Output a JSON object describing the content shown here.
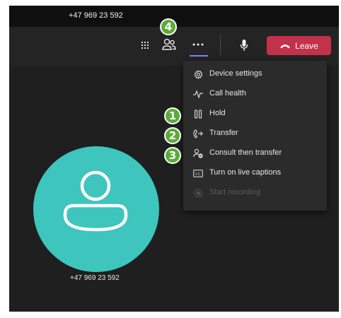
{
  "window": {
    "title": "+47 969 23 592"
  },
  "toolbar": {
    "leave_label": "Leave"
  },
  "menu": {
    "items": [
      {
        "label": "Device settings",
        "icon": "gear-icon"
      },
      {
        "label": "Call health",
        "icon": "pulse-icon"
      },
      {
        "label": "Hold",
        "icon": "pause-icon"
      },
      {
        "label": "Transfer",
        "icon": "transfer-icon"
      },
      {
        "label": "Consult then transfer",
        "icon": "consult-transfer-icon"
      },
      {
        "label": "Turn on live captions",
        "icon": "captions-icon"
      },
      {
        "label": "Start recording",
        "icon": "record-icon",
        "disabled": true
      }
    ]
  },
  "call": {
    "caller_number": "+47 969 23 592"
  },
  "badges": [
    "1",
    "2",
    "3",
    "4"
  ],
  "colors": {
    "leave": "#c4314b",
    "avatar": "#3ec5bd",
    "badge": "#5cab3a",
    "accent_underline": "#7f85f5"
  }
}
